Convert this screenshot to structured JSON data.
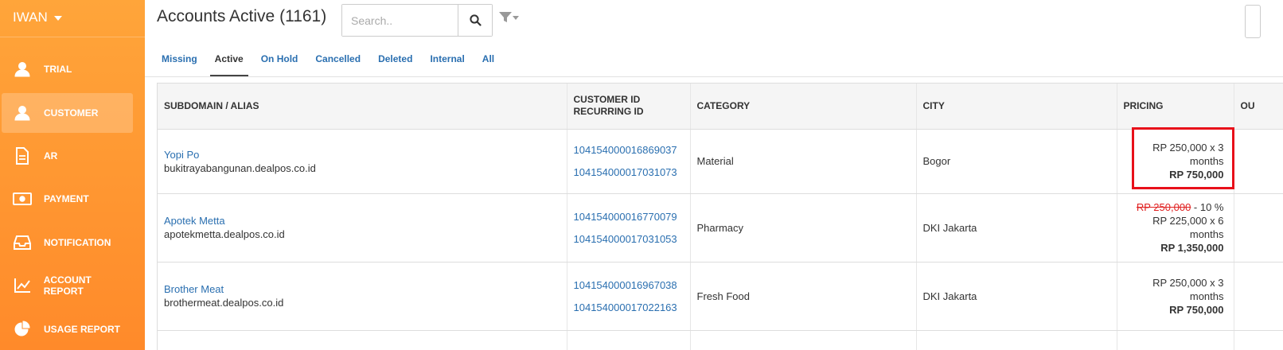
{
  "sidebar": {
    "user": "IWAN",
    "items": [
      {
        "label": "TRIAL",
        "icon": "person-icon"
      },
      {
        "label": "CUSTOMER",
        "icon": "person-icon"
      },
      {
        "label": "AR",
        "icon": "document-icon"
      },
      {
        "label": "PAYMENT",
        "icon": "cash-icon"
      },
      {
        "label": "NOTIFICATION",
        "icon": "inbox-icon"
      },
      {
        "label": "ACCOUNT REPORT",
        "icon": "line-chart-icon"
      },
      {
        "label": "USAGE REPORT",
        "icon": "pie-chart-icon"
      }
    ],
    "active_index": 1
  },
  "header": {
    "title": "Accounts Active (1161)",
    "search_placeholder": "Search..",
    "search_value": ""
  },
  "tabs": [
    {
      "label": "Missing"
    },
    {
      "label": "Active"
    },
    {
      "label": "On Hold"
    },
    {
      "label": "Cancelled"
    },
    {
      "label": "Deleted"
    },
    {
      "label": "Internal"
    },
    {
      "label": "All"
    }
  ],
  "active_tab": "Active",
  "table": {
    "headers": {
      "subdomain": "SUBDOMAIN / ALIAS",
      "customer_id": "CUSTOMER ID",
      "recurring_id": "RECURRING ID",
      "category": "CATEGORY",
      "city": "CITY",
      "pricing": "PRICING",
      "extra": "OU"
    },
    "rows": [
      {
        "name": "Yopi Po",
        "domain": "bukitrayabangunan.dealpos.co.id",
        "customer_id": "104154000016869037",
        "recurring_id": "104154000017031073",
        "category": "Material",
        "city": "Bogor",
        "pricing_line": "RP 250,000 x 3",
        "pricing_period": "months",
        "pricing_total": "RP 750,000"
      },
      {
        "name": "Apotek Metta",
        "domain": "apotekmetta.dealpos.co.id",
        "customer_id": "104154000016770079",
        "recurring_id": "104154000017031053",
        "category": "Pharmacy",
        "city": "DKI Jakarta",
        "pricing_original": "RP 250,000",
        "pricing_discount": " - 10 %",
        "pricing_line": "RP 225,000 x 6",
        "pricing_period": "months",
        "pricing_total": "RP 1,350,000"
      },
      {
        "name": "Brother Meat",
        "domain": "brothermeat.dealpos.co.id",
        "customer_id": "104154000016967038",
        "recurring_id": "104154000017022163",
        "category": "Fresh Food",
        "city": "DKI Jakarta",
        "pricing_line": "RP 250,000 x 3",
        "pricing_period": "months",
        "pricing_total": "RP 750,000"
      }
    ]
  },
  "colors": {
    "sidebar_top": "#ffa53a",
    "sidebar_bottom": "#ff8a2a",
    "link": "#2a6fb0",
    "highlight": "#e8101a"
  }
}
